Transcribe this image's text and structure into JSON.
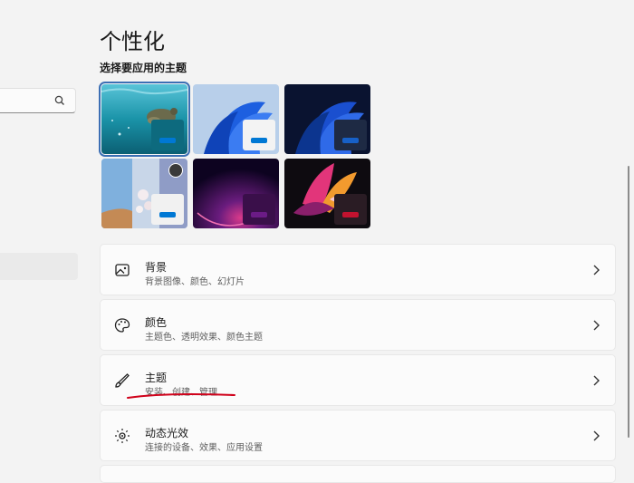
{
  "page": {
    "title": "个性化"
  },
  "themes": {
    "heading": "选择要应用的主题",
    "items": [
      {
        "name": "underwater",
        "accent": "#0078d4",
        "selected": true
      },
      {
        "name": "windows-light",
        "accent": "#0078d4"
      },
      {
        "name": "windows-dark",
        "accent": "#1760c7"
      },
      {
        "name": "glow",
        "accent": "#0078d4"
      },
      {
        "name": "captured-motion",
        "accent": "#6b1b86"
      },
      {
        "name": "flow",
        "accent": "#c2122f"
      }
    ]
  },
  "settings": [
    {
      "title": "背景",
      "desc": "背景图像、颜色、幻灯片",
      "icon": "picture-icon"
    },
    {
      "title": "颜色",
      "desc": "主题色、透明效果、颜色主题",
      "icon": "palette-icon"
    },
    {
      "title": "主题",
      "desc": "安装、创建、管理",
      "icon": "brush-icon"
    },
    {
      "title": "动态光效",
      "desc": "连接的设备、效果、应用设置",
      "icon": "lighting-icon"
    }
  ],
  "colors": {
    "accent": "#0078d4",
    "annotation": "#d0021b"
  }
}
